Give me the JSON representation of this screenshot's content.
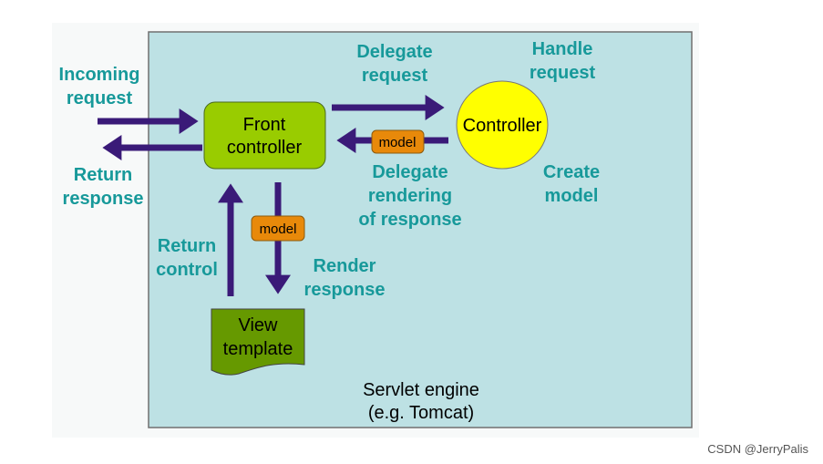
{
  "colors": {
    "frame_fill": "#bde1e4",
    "arrow": "#3a1a78",
    "label": "#17999a",
    "front_controller": "#99cc00",
    "controller": "#ffff00",
    "view_template": "#669900",
    "model_badge": "#e8890a"
  },
  "labels": {
    "incoming_1": "Incoming",
    "incoming_2": "request",
    "return_1": "Return",
    "return_2": "response",
    "delegate_req_1": "Delegate",
    "delegate_req_2": "request",
    "handle_1": "Handle",
    "handle_2": "request",
    "delegate_render_1": "Delegate",
    "delegate_render_2": "rendering",
    "delegate_render_3": "of response",
    "create_1": "Create",
    "create_2": "model",
    "return_control_1": "Return",
    "return_control_2": "control",
    "render_1": "Render",
    "render_2": "response"
  },
  "nodes": {
    "front_1": "Front",
    "front_2": "controller",
    "controller": "Controller",
    "view_1": "View",
    "view_2": "template",
    "model_a": "model",
    "model_b": "model",
    "engine_1": "Servlet engine",
    "engine_2": "(e.g. Tomcat)"
  },
  "watermark": "CSDN @JerryPalis"
}
